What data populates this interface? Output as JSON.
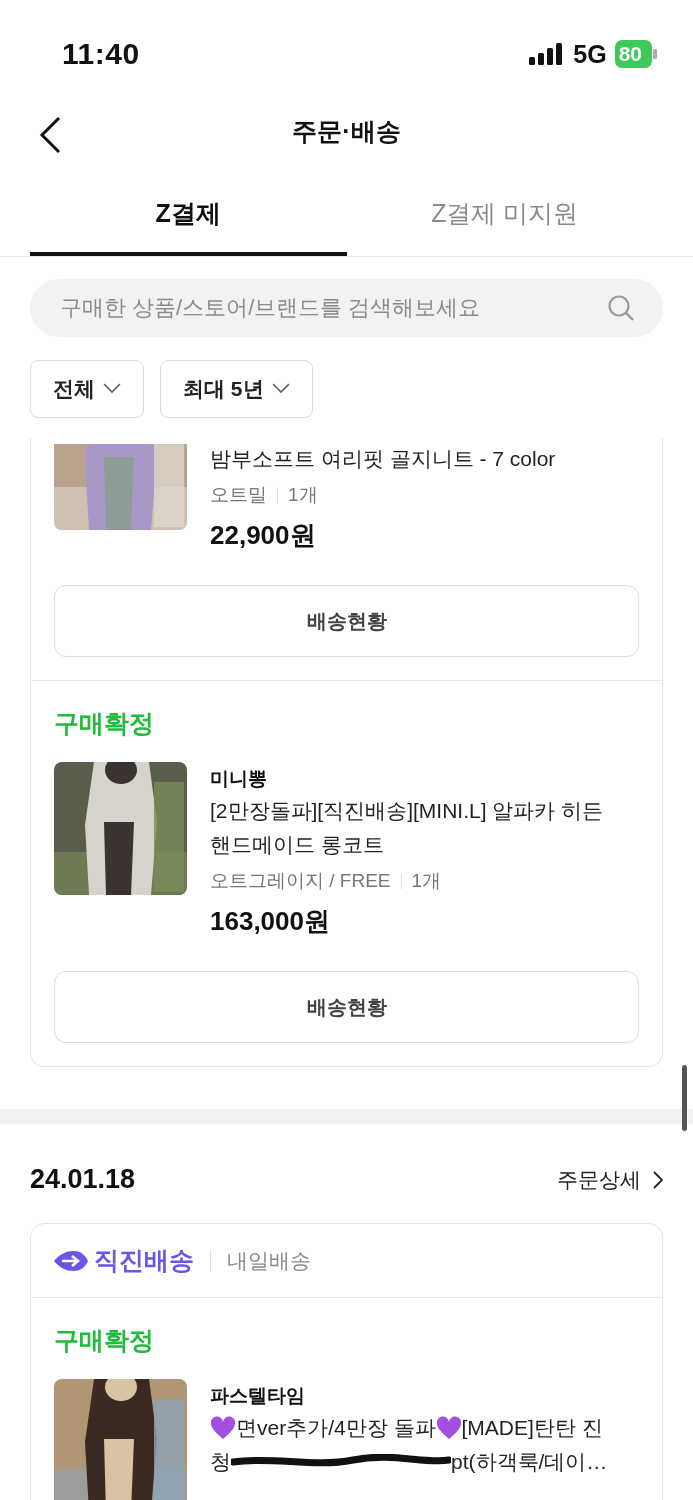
{
  "status_bar": {
    "time": "11:40",
    "network": "5G",
    "battery": "80"
  },
  "header": {
    "title": "주문·배송"
  },
  "tabs": [
    {
      "label": "Z결제",
      "selected": true
    },
    {
      "label": "Z결제 미지원",
      "selected": false
    }
  ],
  "search": {
    "placeholder": "구매한 상품/스토어/브랜드를 검색해보세요"
  },
  "filters": [
    {
      "label": "전체"
    },
    {
      "label": "최대 5년"
    }
  ],
  "orders": [
    {
      "cut_top": true,
      "items": [
        {
          "title_lines": [
            [
              {
                "kind": "text",
                "text": "밤부소프트 여리핏 골지니트 - 7 color"
              }
            ]
          ],
          "option": "오트밀",
          "quantity": "1개",
          "price": "22,900원",
          "button": "배송현황"
        },
        {
          "status": "구매확정",
          "store": "미니뽕",
          "title_lines": [
            [
              {
                "kind": "text",
                "text": "[2만장돌파][직진배송][MINI.L] 알파카 히든"
              }
            ],
            [
              {
                "kind": "text",
                "text": "핸드메이드 롱코트"
              }
            ]
          ],
          "option": "오트그레이지 / FREE",
          "quantity": "1개",
          "price": "163,000원",
          "button": "배송현황"
        }
      ]
    },
    {
      "date": "24.01.18",
      "detail_link": "주문상세",
      "delivery": {
        "brand": "직진배송",
        "note": "내일배송"
      },
      "items": [
        {
          "status": "구매확정",
          "store": "파스텔타임",
          "title_lines": [
            [
              {
                "kind": "heart"
              },
              {
                "kind": "text",
                "text": "면ver추가/4만장 돌파"
              },
              {
                "kind": "heart"
              },
              {
                "kind": "text",
                "text": "[MADE]탄탄 진"
              }
            ],
            [
              {
                "kind": "text",
                "text": "청"
              },
              {
                "kind": "redacted"
              },
              {
                "kind": "text",
                "text": "pt(하객룩/데이…"
              }
            ]
          ]
        }
      ]
    }
  ]
}
